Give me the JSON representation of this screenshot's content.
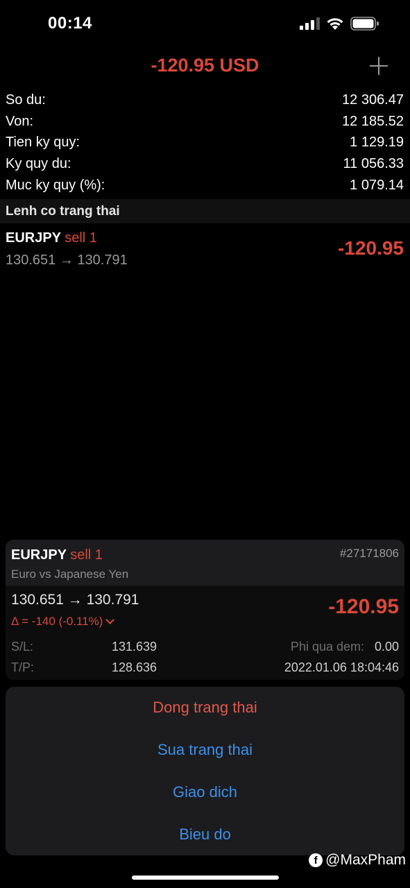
{
  "status_bar": {
    "time": "00:14"
  },
  "header": {
    "total_pl": "-120.95 USD"
  },
  "summary": [
    {
      "label": "So du:",
      "value": "12 306.47"
    },
    {
      "label": "Von:",
      "value": "12 185.52"
    },
    {
      "label": "Tien ky quy:",
      "value": "1 129.19"
    },
    {
      "label": "Ky quy du:",
      "value": "11 056.33"
    },
    {
      "label": "Muc ky quy (%):",
      "value": "1 079.14"
    }
  ],
  "positions_section": {
    "title": "Lenh co trang thai"
  },
  "position": {
    "symbol": "EURJPY",
    "type": "sell 1",
    "prices": "130.651 → 130.791",
    "pl": "-120.95"
  },
  "detail": {
    "symbol": "EURJPY",
    "type": "sell 1",
    "ticket": "#27171806",
    "description": "Euro vs Japanese Yen",
    "prices": "130.651 → 130.791",
    "delta": "Δ = -140 (-0.11%)",
    "pl": "-120.95",
    "sl_label": "S/L:",
    "sl_value": "131.639",
    "tp_label": "T/P:",
    "tp_value": "128.636",
    "swap_label": "Phi qua dem:",
    "swap_value": "0.00",
    "open_time": "2022.01.06 18:04:46"
  },
  "actions": [
    {
      "label": "Dong trang thai",
      "kind": "destructive"
    },
    {
      "label": "Sua trang thai",
      "kind": "default"
    },
    {
      "label": "Giao dich",
      "kind": "default"
    },
    {
      "label": "Bieu do",
      "kind": "default"
    }
  ],
  "watermark": {
    "icon": "facebook-icon",
    "text": "@MaxPham"
  },
  "colors": {
    "loss": "#d9483b",
    "action": "#3e8fe8",
    "background": "#000000"
  }
}
